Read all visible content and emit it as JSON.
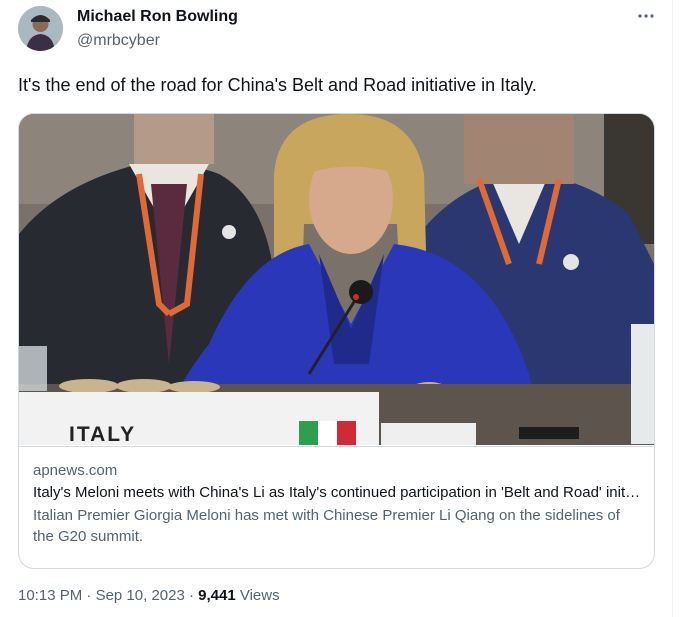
{
  "author": {
    "display_name": "Michael Ron Bowling",
    "handle": "@mrbcyber",
    "avatar_icon": "user-avatar-photo"
  },
  "more_icon": "ellipsis-icon",
  "tweet": {
    "text": "It's the end of the road for China's Belt and Road initiative in Italy."
  },
  "card": {
    "image_placard_text": "ITALY",
    "domain": "apnews.com",
    "title": "Italy's Meloni meets with China's Li as Italy's continued participation in 'Belt and Road' initiative is in doubt",
    "description": "Italian Premier Giorgia Meloni has met with Chinese Premier Li Qiang on the sidelines of the G20 summit."
  },
  "meta": {
    "time": "10:13 PM",
    "separator_1": " · ",
    "date": "Sep 10, 2023",
    "separator_2": " · ",
    "views_count": "9,441",
    "views_label": " Views"
  },
  "colors": {
    "primary_text": "#0f1419",
    "secondary_text": "#536471",
    "border": "#cfd9de",
    "blazer_blue": "#2a37b8"
  }
}
